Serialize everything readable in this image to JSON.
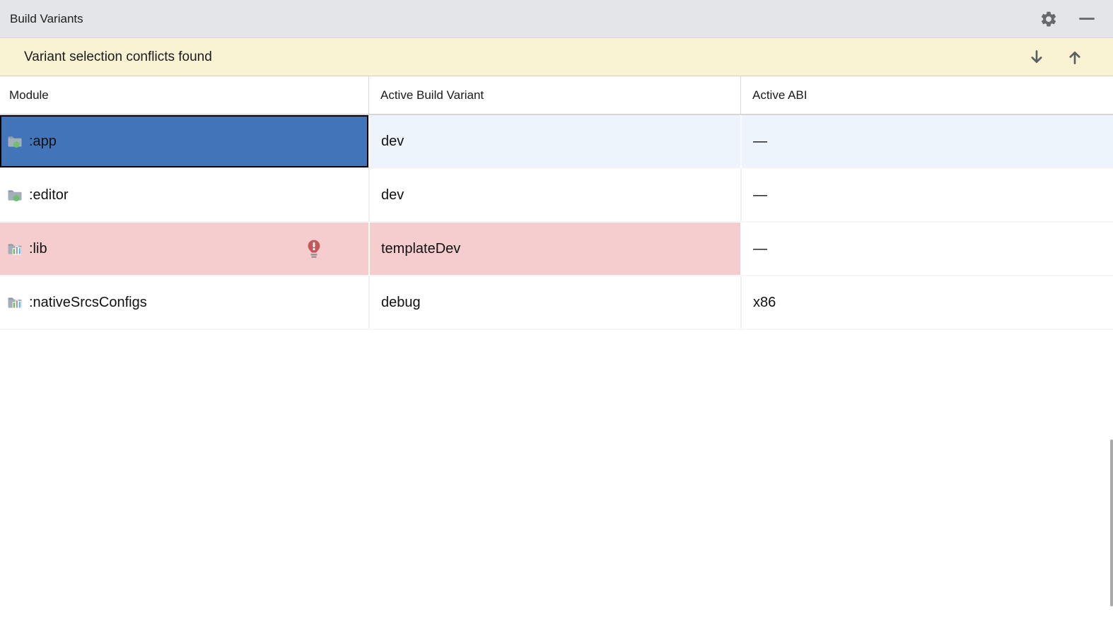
{
  "header": {
    "title": "Build Variants",
    "settings_icon": "gear-icon",
    "minimize_icon": "minimize-icon"
  },
  "banner": {
    "message": "Variant selection conflicts found",
    "next_icon": "down-arrow-icon",
    "previous_icon": "up-arrow-icon"
  },
  "table": {
    "columns": [
      {
        "label": "Module"
      },
      {
        "label": "Active Build Variant"
      },
      {
        "label": "Active ABI"
      }
    ],
    "rows": [
      {
        "module": ":app",
        "icon": "android-module-icon",
        "variant": "dev",
        "abi": "—",
        "selected": true,
        "conflict": false
      },
      {
        "module": ":editor",
        "icon": "android-module-icon",
        "variant": "dev",
        "abi": "—",
        "selected": false,
        "conflict": false
      },
      {
        "module": ":lib",
        "icon": "library-module-icon",
        "variant": "templateDev",
        "abi": "—",
        "selected": false,
        "conflict": true,
        "error_icon": "error-bulb-icon"
      },
      {
        "module": ":nativeSrcsConfigs",
        "icon": "library-module-icon",
        "variant": "debug",
        "abi": "x86",
        "selected": false,
        "conflict": false
      }
    ]
  },
  "colors": {
    "titlebar_bg": "#E3E5E9",
    "banner_bg": "#FAF3D3",
    "selection_blue": "#4274B9",
    "selected_row_tint": "#EDF4FB",
    "conflict_pink": "#F5CDCF",
    "error_red": "#C4575C",
    "module_icon_gray": "#A3AEB9",
    "module_icon_green": "#6CC06F",
    "bar_green": "#7CB156",
    "bar_blue": "#6FB1E4",
    "icon_gray": "#63676C"
  }
}
